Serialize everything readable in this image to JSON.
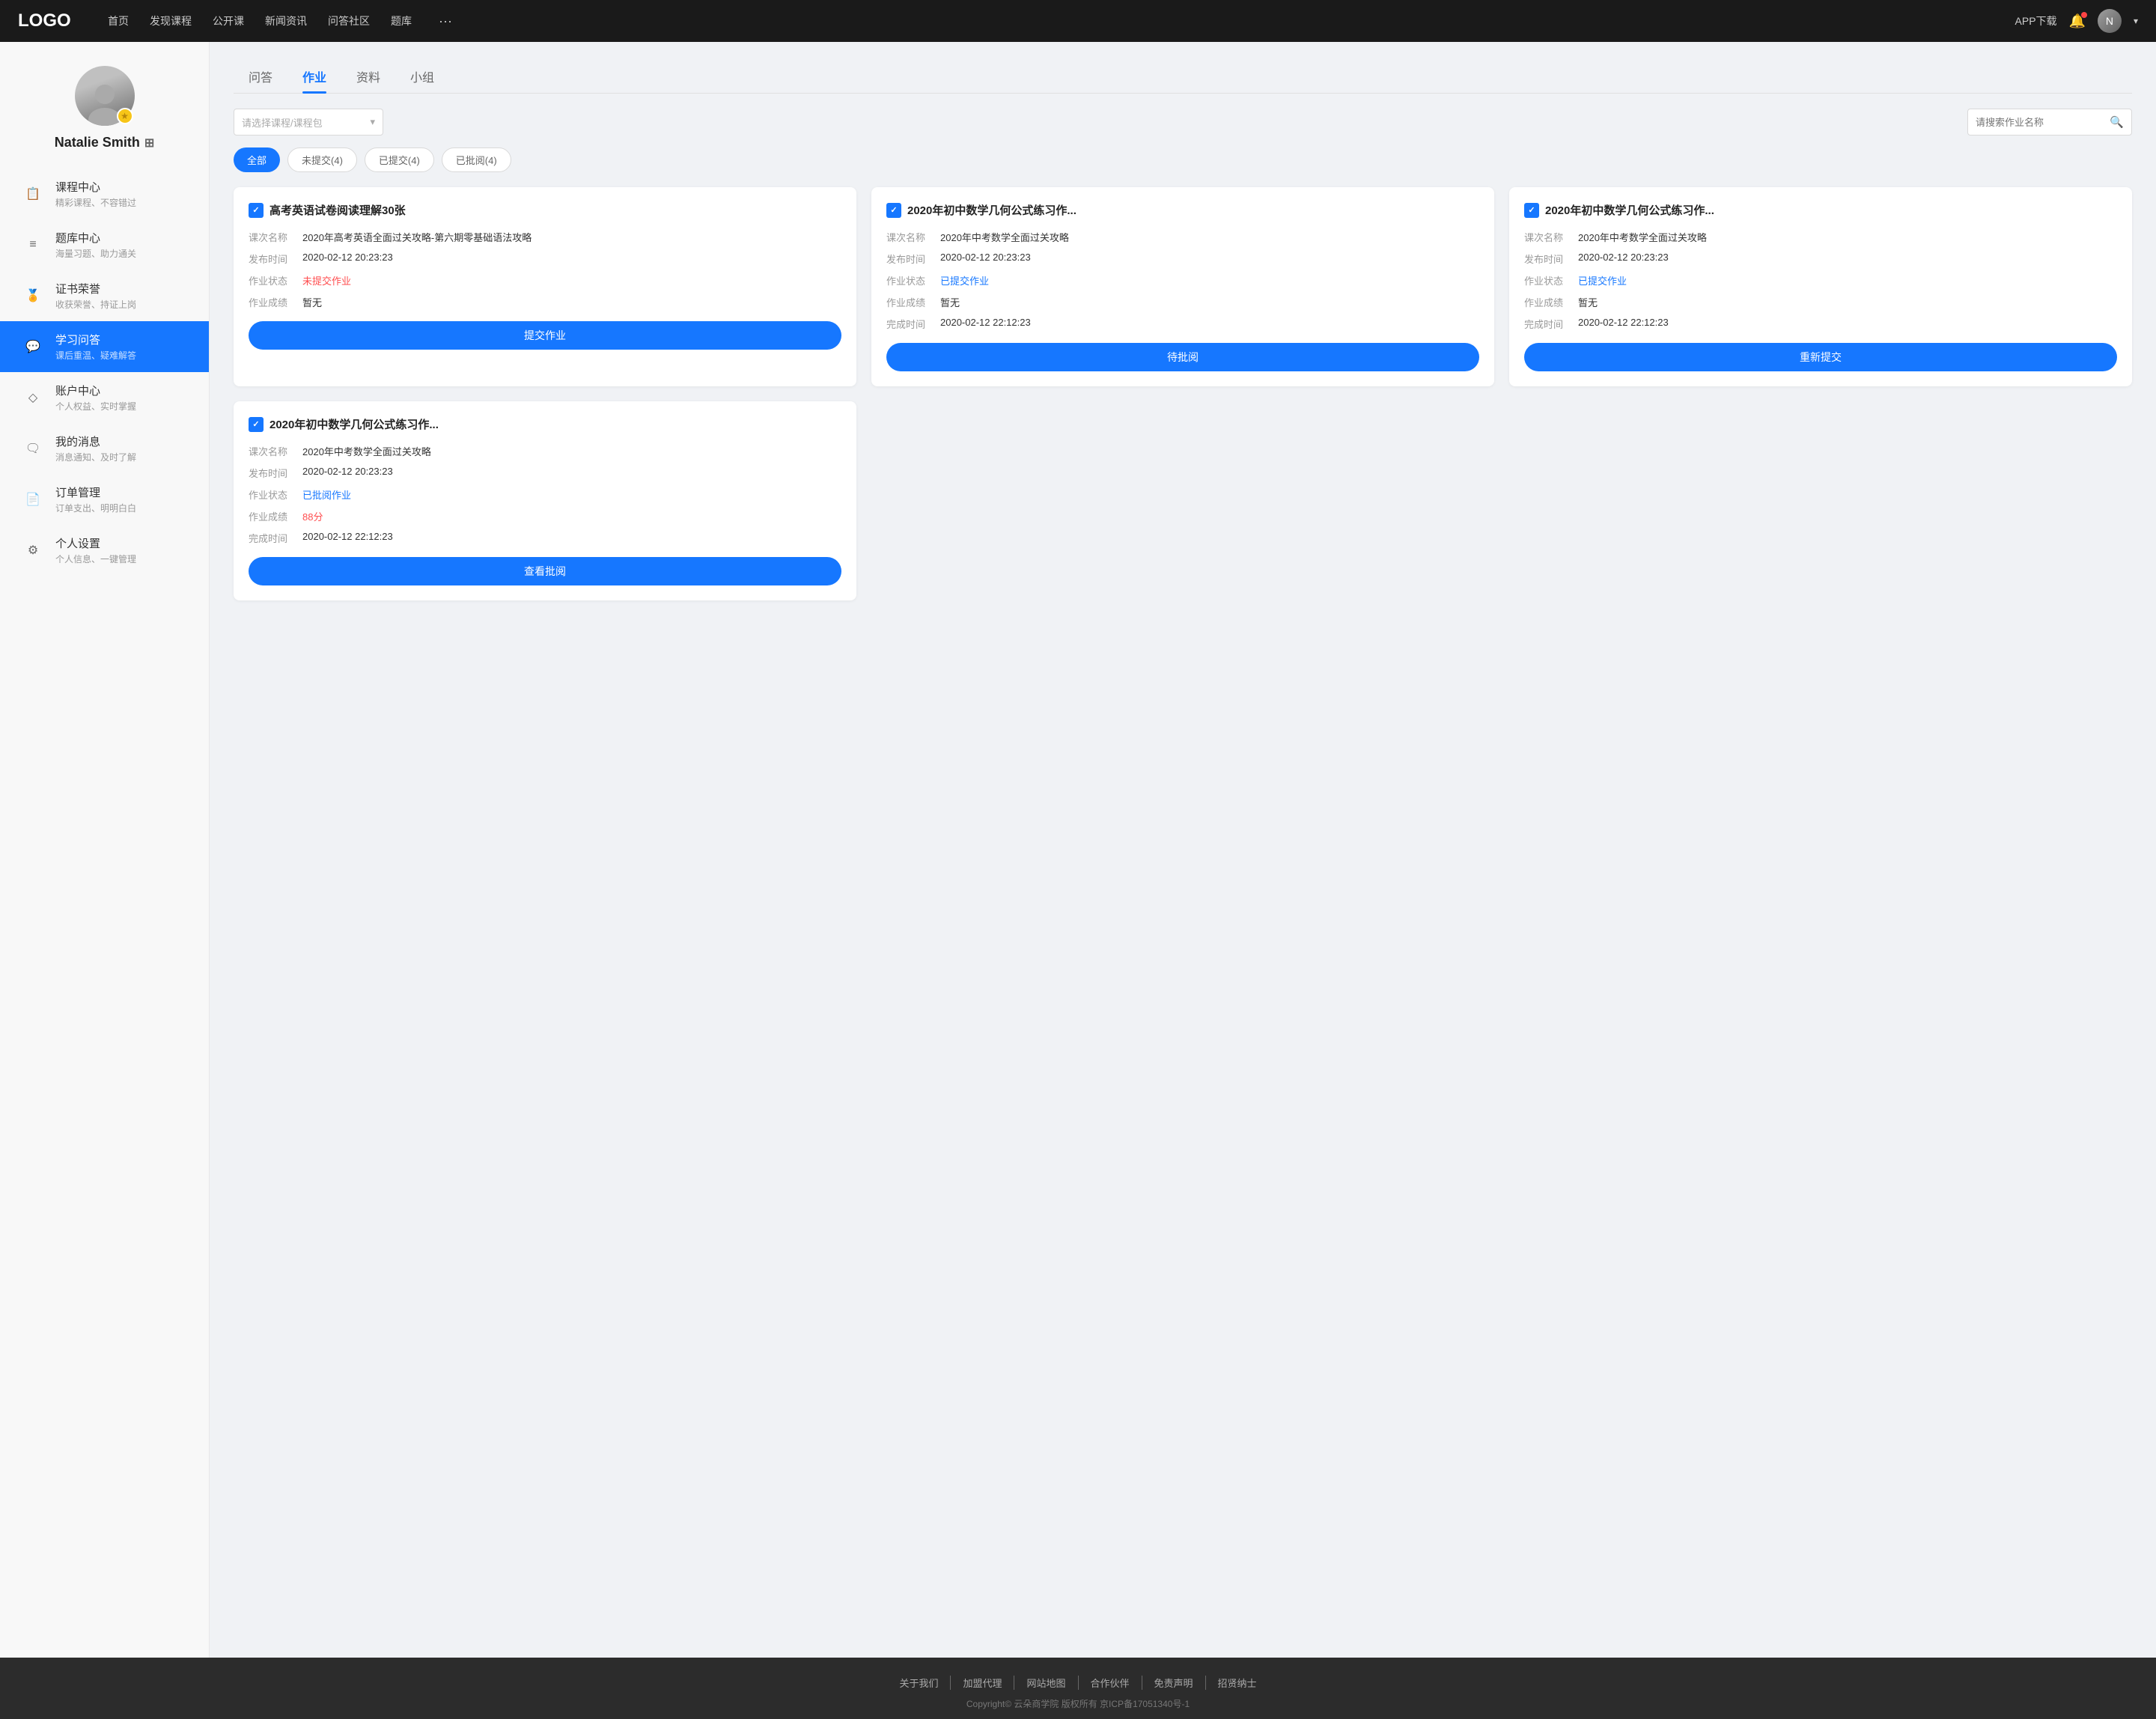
{
  "navbar": {
    "logo": "LOGO",
    "nav_items": [
      "首页",
      "发现课程",
      "公开课",
      "新闻资讯",
      "问答社区",
      "题库"
    ],
    "more": "···",
    "download": "APP下载",
    "bell_label": "bell",
    "chevron": "▾"
  },
  "sidebar": {
    "username": "Natalie Smith",
    "badge": "★",
    "menu_items": [
      {
        "id": "courses",
        "icon": "📋",
        "title": "课程中心",
        "sub": "精彩课程、不容错过",
        "active": false
      },
      {
        "id": "questions",
        "icon": "≡",
        "title": "题库中心",
        "sub": "海量习题、助力通关",
        "active": false
      },
      {
        "id": "certificates",
        "icon": "⚙",
        "title": "证书荣誉",
        "sub": "收获荣誉、持证上岗",
        "active": false
      },
      {
        "id": "qa",
        "icon": "💬",
        "title": "学习问答",
        "sub": "课后重温、疑难解答",
        "active": true
      },
      {
        "id": "account",
        "icon": "◇",
        "title": "账户中心",
        "sub": "个人权益、实时掌握",
        "active": false
      },
      {
        "id": "messages",
        "icon": "🗨",
        "title": "我的消息",
        "sub": "消息通知、及时了解",
        "active": false
      },
      {
        "id": "orders",
        "icon": "📄",
        "title": "订单管理",
        "sub": "订单支出、明明白白",
        "active": false
      },
      {
        "id": "settings",
        "icon": "⚙",
        "title": "个人设置",
        "sub": "个人信息、一键管理",
        "active": false
      }
    ]
  },
  "tabs": {
    "items": [
      "问答",
      "作业",
      "资料",
      "小组"
    ],
    "active": "作业"
  },
  "filter": {
    "course_placeholder": "请选择课程/课程包",
    "search_placeholder": "请搜索作业名称"
  },
  "status_filters": [
    {
      "label": "全部",
      "active": true
    },
    {
      "label": "未提交(4)",
      "active": false
    },
    {
      "label": "已提交(4)",
      "active": false
    },
    {
      "label": "已批阅(4)",
      "active": false
    }
  ],
  "homework_cards": [
    {
      "id": "hw1",
      "title": "高考英语试卷阅读理解30张",
      "course_label": "课次名称",
      "course_value": "2020年高考英语全面过关攻略-第六期零基础语法攻略",
      "publish_label": "发布时间",
      "publish_value": "2020-02-12 20:23:23",
      "status_label": "作业状态",
      "status_value": "未提交作业",
      "status_type": "not-submitted",
      "score_label": "作业成绩",
      "score_value": "暂无",
      "score_type": "",
      "complete_label": "",
      "complete_value": "",
      "button": "提交作业"
    },
    {
      "id": "hw2",
      "title": "2020年初中数学几何公式练习作...",
      "course_label": "课次名称",
      "course_value": "2020年中考数学全面过关攻略",
      "publish_label": "发布时间",
      "publish_value": "2020-02-12 20:23:23",
      "status_label": "作业状态",
      "status_value": "已提交作业",
      "status_type": "submitted",
      "score_label": "作业成绩",
      "score_value": "暂无",
      "score_type": "",
      "complete_label": "完成时间",
      "complete_value": "2020-02-12 22:12:23",
      "button": "待批阅"
    },
    {
      "id": "hw3",
      "title": "2020年初中数学几何公式练习作...",
      "course_label": "课次名称",
      "course_value": "2020年中考数学全面过关攻略",
      "publish_label": "发布时间",
      "publish_value": "2020-02-12 20:23:23",
      "status_label": "作业状态",
      "status_value": "已提交作业",
      "status_type": "submitted",
      "score_label": "作业成绩",
      "score_value": "暂无",
      "score_type": "",
      "complete_label": "完成时间",
      "complete_value": "2020-02-12 22:12:23",
      "button": "重新提交"
    },
    {
      "id": "hw4",
      "title": "2020年初中数学几何公式练习作...",
      "course_label": "课次名称",
      "course_value": "2020年中考数学全面过关攻略",
      "publish_label": "发布时间",
      "publish_value": "2020-02-12 20:23:23",
      "status_label": "作业状态",
      "status_value": "已批阅作业",
      "status_type": "reviewed",
      "score_label": "作业成绩",
      "score_value": "88分",
      "score_type": "score-red",
      "complete_label": "完成时间",
      "complete_value": "2020-02-12 22:12:23",
      "button": "查看批阅"
    }
  ],
  "footer": {
    "links": [
      "关于我们",
      "加盟代理",
      "网站地图",
      "合作伙伴",
      "免责声明",
      "招贤纳士"
    ],
    "copyright": "Copyright© 云朵商学院  版权所有    京ICP备17051340号-1"
  }
}
